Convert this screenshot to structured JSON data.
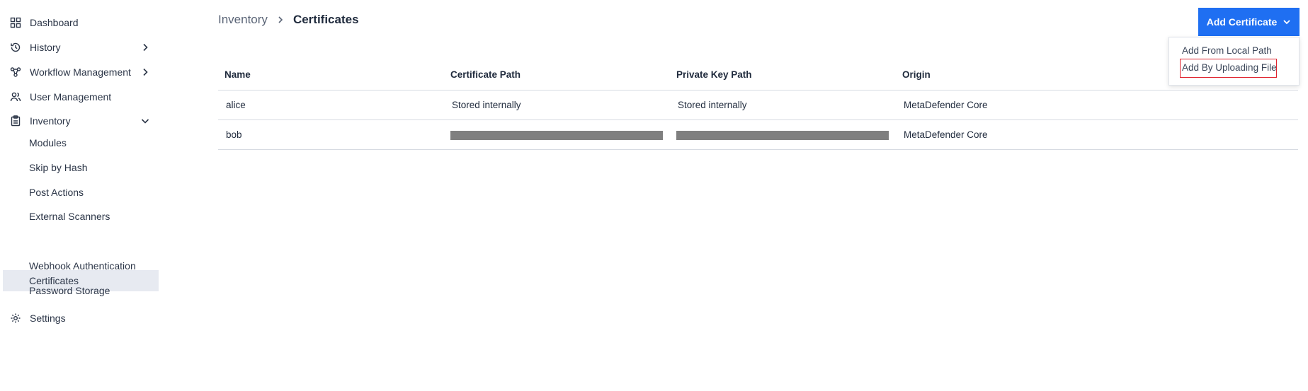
{
  "sidebar": {
    "items": [
      {
        "label": "Dashboard",
        "icon": "grid-icon"
      },
      {
        "label": "History",
        "icon": "history-icon"
      },
      {
        "label": "Workflow Management",
        "icon": "workflow-icon"
      },
      {
        "label": "User Management",
        "icon": "users-icon"
      },
      {
        "label": "Inventory",
        "icon": "clipboard-icon"
      },
      {
        "label": "Settings",
        "icon": "gear-icon"
      }
    ],
    "inventory_sub": [
      {
        "label": "Modules"
      },
      {
        "label": "Skip by Hash"
      },
      {
        "label": "Post Actions"
      },
      {
        "label": "External Scanners"
      },
      {
        "label": "Certificates",
        "active": true
      },
      {
        "label": "Webhook Authentication"
      },
      {
        "label": "Password Storage"
      }
    ]
  },
  "breadcrumb": {
    "parent": "Inventory",
    "current": "Certificates"
  },
  "add_button": {
    "label": "Add Certificate",
    "color": "#1f6ff2"
  },
  "dropdown": {
    "items": [
      "Add From Local Path",
      "Add By Uploading File"
    ],
    "highlighted_index": 1
  },
  "table": {
    "columns": [
      "Name",
      "Certificate Path",
      "Private Key Path",
      "Origin"
    ],
    "rows": [
      {
        "name": "alice",
        "certificate_path": "Stored internally",
        "private_key_path": "Stored internally",
        "origin": "MetaDefender Core",
        "redacted": false
      },
      {
        "name": "bob",
        "certificate_path": "",
        "private_key_path": "",
        "origin": "MetaDefender Core",
        "redacted": true
      }
    ]
  }
}
